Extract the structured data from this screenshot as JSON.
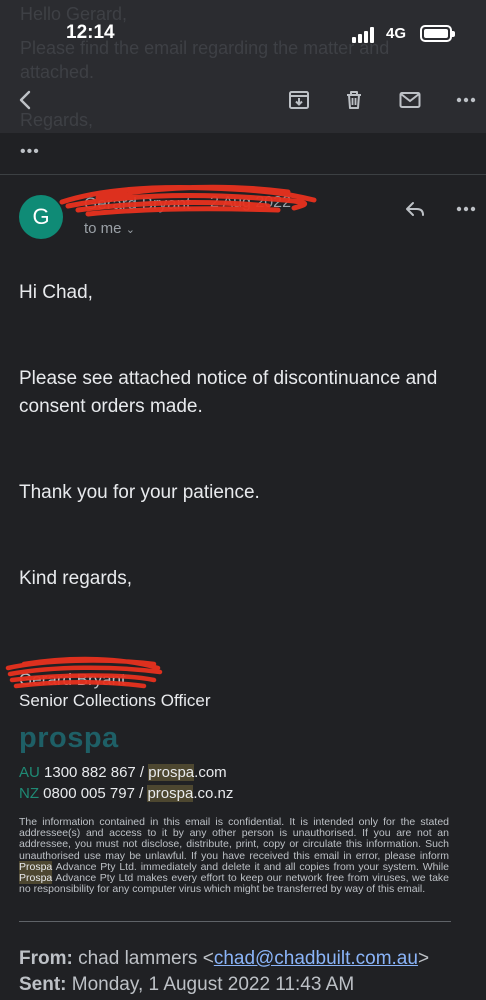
{
  "status_bar": {
    "time": "12:14",
    "network": "4G"
  },
  "background_text": {
    "line1": "Hello Gerard,",
    "line2": "Please find the email regarding the matter and",
    "line3": "attached.",
    "line4": "Regards,"
  },
  "toolbar": {
    "back_icon": "arrow-left-icon",
    "archive_icon": "archive-icon",
    "delete_icon": "trash-icon",
    "mark_unread_icon": "mail-icon",
    "more_icon": "more-horizontal-icon"
  },
  "thread": {
    "collapsed_label": "•••"
  },
  "email": {
    "avatar_letter": "G",
    "sender_name": "Gerard Bryant",
    "date": "2 Aug 2022",
    "to_label": "to me",
    "greeting": "Hi Chad,",
    "paragraph1": "Please see attached notice of discontinuance and consent orders made.",
    "paragraph2": "Thank you for your patience.",
    "sign_off": "Kind regards,",
    "signature": {
      "name": "Gerard Bryant",
      "title": "Senior Collections Officer",
      "logo": "prospa",
      "au": {
        "code": "AU",
        "phone": " 1300 882 867 / ",
        "site_brand": "prospa",
        "site_rest": ".com"
      },
      "nz": {
        "code": "NZ",
        "phone": " 0800 005 797 / ",
        "site_brand": "prospa",
        "site_rest": ".co.nz"
      }
    },
    "disclaimer": {
      "part1": "The information contained in this email is confidential. It is intended only for the stated addressee(s) and access to it by any other person is unauthorised. If you are not an addressee, you must not disclose, distribute, print, copy or circulate this information. Such unauthorised use may be unlawful. If you have received this email in error, please inform ",
      "brand1": "Prospa",
      "part2": " Advance Pty Ltd. immediately and delete it and all copies from your system. While ",
      "brand2": "Prospa",
      "part3": " Advance Pty Ltd makes every effort to keep our network free from viruses, we take no responsibility for any computer virus which might be transferred by way of this email."
    },
    "quoted": {
      "from_label": "From:",
      "from_name": " chad lammers <",
      "from_email": "chad@chadbuilt.com.au",
      "from_close": ">",
      "sent_label": "Sent:",
      "sent_value": " Monday, 1 August 2022 11:43 AM"
    }
  },
  "colors": {
    "avatar": "#0f8b76",
    "redaction": "#e8321f",
    "link": "#8ab4f8",
    "brand_teal": "#1e5f66"
  }
}
